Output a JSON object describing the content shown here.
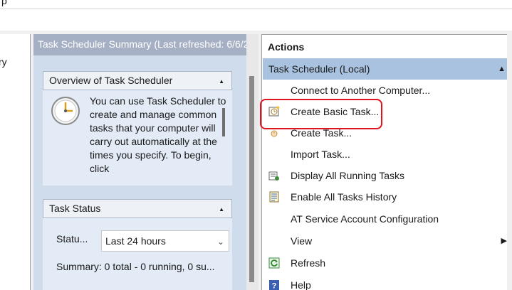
{
  "window": {
    "menu_fragment": "p"
  },
  "left_pane": {
    "item_fragment": "ry"
  },
  "summary": {
    "header": "Task Scheduler Summary (Last refreshed: 6/6/2",
    "overview": {
      "title": "Overview of Task Scheduler",
      "text": "You can use Task Scheduler to create and manage common tasks that your computer will carry out automatically at the times you specify. To begin, click"
    },
    "task_status": {
      "title": "Task Status",
      "status_label": "Statu...",
      "status_value": "Last 24 hours",
      "summary_line": "Summary: 0 total - 0 running, 0 su..."
    }
  },
  "actions": {
    "title": "Actions",
    "group": "Task Scheduler (Local)",
    "items": [
      {
        "label": "Connect to Another Computer...",
        "icon": "none"
      },
      {
        "label": "Create Basic Task...",
        "icon": "create-basic-task-icon"
      },
      {
        "label": "Create Task...",
        "icon": "create-task-icon"
      },
      {
        "label": "Import Task...",
        "icon": "none"
      },
      {
        "label": "Display All Running Tasks",
        "icon": "running-tasks-icon"
      },
      {
        "label": "Enable All Tasks History",
        "icon": "tasks-history-icon"
      },
      {
        "label": "AT Service Account Configuration",
        "icon": "none"
      },
      {
        "label": "View",
        "icon": "none"
      },
      {
        "label": "Refresh",
        "icon": "refresh-icon"
      },
      {
        "label": "Help",
        "icon": "help-icon"
      }
    ]
  },
  "colors": {
    "center_header": "#a6b0c4",
    "center_body": "#cfdcec",
    "actions_group": "#a8c2e0",
    "highlight": "#e0141e"
  }
}
